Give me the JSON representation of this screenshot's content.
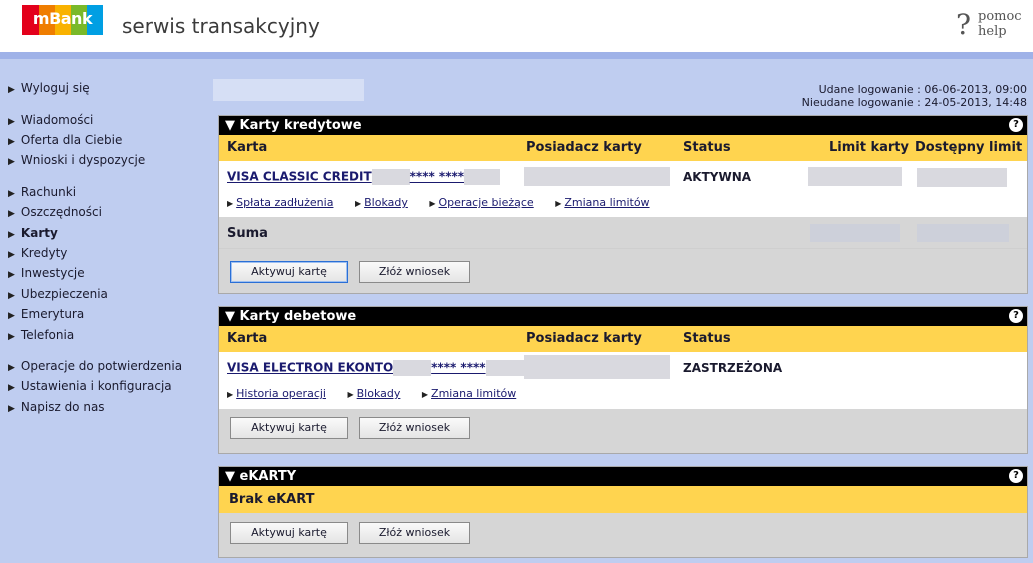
{
  "header": {
    "logo_text": "mBank",
    "logo_colors": [
      "#e3001b",
      "#ef7d00",
      "#f9b200",
      "#7ab929",
      "#009fe3"
    ],
    "service_title": "serwis transakcyjny",
    "help_glyph": "?",
    "help_pl": "pomoc",
    "help_en": "help"
  },
  "sidebar": {
    "items": [
      {
        "label": "Wyloguj się"
      },
      {
        "label": "Wiadomości"
      },
      {
        "label": "Oferta dla Ciebie"
      },
      {
        "label": "Wnioski i dyspozycje"
      },
      {
        "label": "Rachunki"
      },
      {
        "label": "Oszczędności"
      },
      {
        "label": "Karty",
        "active": true
      },
      {
        "label": "Kredyty"
      },
      {
        "label": "Inwestycje"
      },
      {
        "label": "Ubezpieczenia"
      },
      {
        "label": "Emerytura"
      },
      {
        "label": "Telefonia"
      },
      {
        "label": "Operacje do potwierdzenia"
      },
      {
        "label": "Ustawienia i konfiguracja"
      },
      {
        "label": "Napisz do nas"
      }
    ]
  },
  "login_info": {
    "success": "Udane logowanie : 06-06-2013, 09:00",
    "failed": "Nieudane logowanie : 24-05-2013, 14:48"
  },
  "credit": {
    "title": "Karty kredytowe",
    "help_icon": "?",
    "col_card": "Karta",
    "col_holder": "Posiadacz karty",
    "col_status": "Status",
    "col_limit": "Limit karty",
    "col_available": "Dostępny limit",
    "card_name": "VISA CLASSIC CREDIT",
    "card_mask": "**** ****",
    "status": "AKTYWNA",
    "links": [
      "Spłata zadłużenia",
      "Blokady",
      "Operacje bieżące",
      "Zmiana limitów"
    ],
    "sum_label": "Suma",
    "btn_activate": "Aktywuj kartę",
    "btn_apply": "Złóż wniosek"
  },
  "debit": {
    "title": "Karty debetowe",
    "help_icon": "?",
    "col_card": "Karta",
    "col_holder": "Posiadacz karty",
    "col_status": "Status",
    "card_name": "VISA ELECTRON EKONTO",
    "card_mask": "**** ****",
    "status": "ZASTRZEŻONA",
    "links": [
      "Historia operacji",
      "Blokady",
      "Zmiana limitów"
    ],
    "btn_activate": "Aktywuj kartę",
    "btn_apply": "Złóż wniosek"
  },
  "ekarty": {
    "title": "eKARTY",
    "help_icon": "?",
    "empty_label": "Brak eKART",
    "btn_activate": "Aktywuj kartę",
    "btn_apply": "Złóż wniosek"
  },
  "icons": {
    "panel_toggle": "triangle-down-icon",
    "nav_bullet": "triangle-right-icon"
  }
}
